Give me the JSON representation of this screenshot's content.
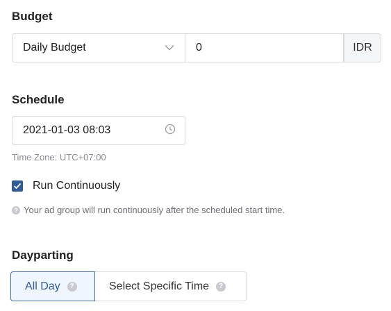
{
  "budget": {
    "title": "Budget",
    "type_selected": "Daily Budget",
    "amount_value": "0",
    "currency": "IDR"
  },
  "schedule": {
    "title": "Schedule",
    "start_datetime": "2021-01-03 08:03",
    "timezone_text": "Time Zone: UTC+07:00",
    "run_continuously_label": "Run Continuously",
    "run_continuously_checked": true,
    "hint_text": "Your ad group will run continuously after the scheduled start time."
  },
  "dayparting": {
    "title": "Dayparting",
    "options": [
      {
        "label": "All Day",
        "selected": true
      },
      {
        "label": "Select Specific Time",
        "selected": false
      }
    ]
  },
  "colors": {
    "accent": "#2e5b9a",
    "border": "#d9d9de",
    "muted_text": "#8a8d93"
  },
  "icons": {
    "select_arrow": "chevron-down-icon",
    "time": "clock-icon",
    "check": "checkmark-icon",
    "help": "question-circle-icon"
  }
}
